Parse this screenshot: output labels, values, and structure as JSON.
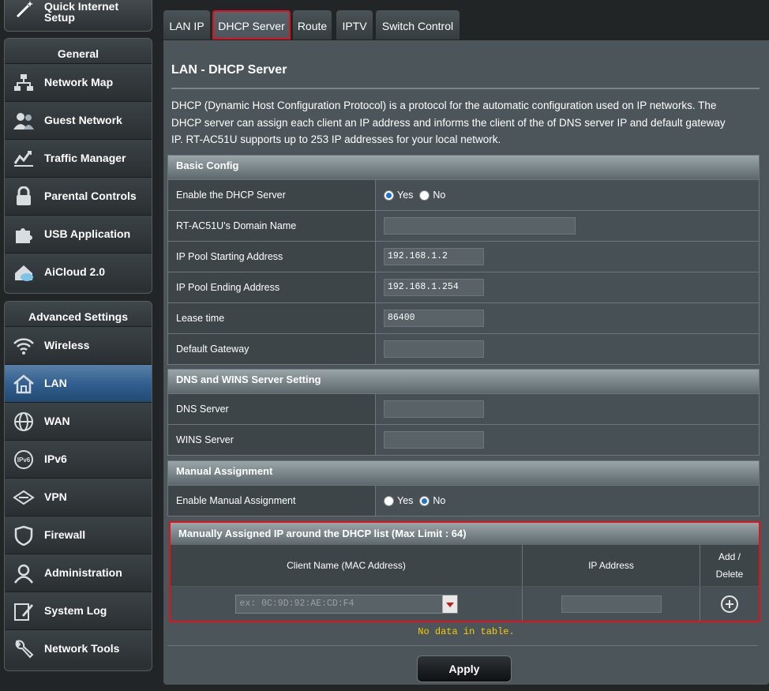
{
  "sidebar": {
    "quick_setup": "Quick Internet Setup",
    "general": {
      "title": "General",
      "items": [
        {
          "label": "Network Map"
        },
        {
          "label": "Guest Network"
        },
        {
          "label": "Traffic Manager"
        },
        {
          "label": "Parental Controls"
        },
        {
          "label": "USB Application"
        },
        {
          "label": "AiCloud 2.0"
        }
      ]
    },
    "advanced": {
      "title": "Advanced Settings",
      "items": [
        {
          "label": "Wireless"
        },
        {
          "label": "LAN"
        },
        {
          "label": "WAN"
        },
        {
          "label": "IPv6"
        },
        {
          "label": "VPN"
        },
        {
          "label": "Firewall"
        },
        {
          "label": "Administration"
        },
        {
          "label": "System Log"
        },
        {
          "label": "Network Tools"
        }
      ],
      "active": "LAN"
    }
  },
  "tabs": [
    {
      "label": "LAN IP"
    },
    {
      "label": "DHCP Server"
    },
    {
      "label": "Route"
    },
    {
      "label": "IPTV"
    },
    {
      "label": "Switch Control"
    }
  ],
  "active_tab": "DHCP Server",
  "page": {
    "title": "LAN - DHCP Server",
    "description": "DHCP (Dynamic Host Configuration Protocol) is a protocol for the automatic configuration used on IP networks. The DHCP server can assign each client an IP address and informs the client of the of DNS server IP and default gateway IP. RT-AC51U supports up to 253 IP addresses for your local network."
  },
  "basic": {
    "title": "Basic Config",
    "enable_label": "Enable the DHCP Server",
    "yes": "Yes",
    "no": "No",
    "enable_value": "Yes",
    "domain_label": "RT-AC51U's Domain Name",
    "domain_value": "",
    "start_label": "IP Pool Starting Address",
    "start_value": "192.168.1.2",
    "end_label": "IP Pool Ending Address",
    "end_value": "192.168.1.254",
    "lease_label": "Lease time",
    "lease_value": "86400",
    "gateway_label": "Default Gateway",
    "gateway_value": ""
  },
  "dns": {
    "title": "DNS and WINS Server Setting",
    "dns_label": "DNS Server",
    "dns_value": "",
    "wins_label": "WINS Server",
    "wins_value": ""
  },
  "manual": {
    "title": "Manual Assignment",
    "enable_label": "Enable Manual Assignment",
    "yes": "Yes",
    "no": "No",
    "enable_value": "No"
  },
  "manual_list": {
    "title": "Manually Assigned IP around the DHCP list (Max Limit : 64)",
    "col_client": "Client Name (MAC Address)",
    "col_ip": "IP Address",
    "col_action_1": "Add /",
    "col_action_2": "Delete",
    "mac_placeholder": "ex: 0C:9D:92:AE:CD:F4",
    "ip_value": "",
    "empty_text": "No data in table."
  },
  "apply_label": "Apply"
}
